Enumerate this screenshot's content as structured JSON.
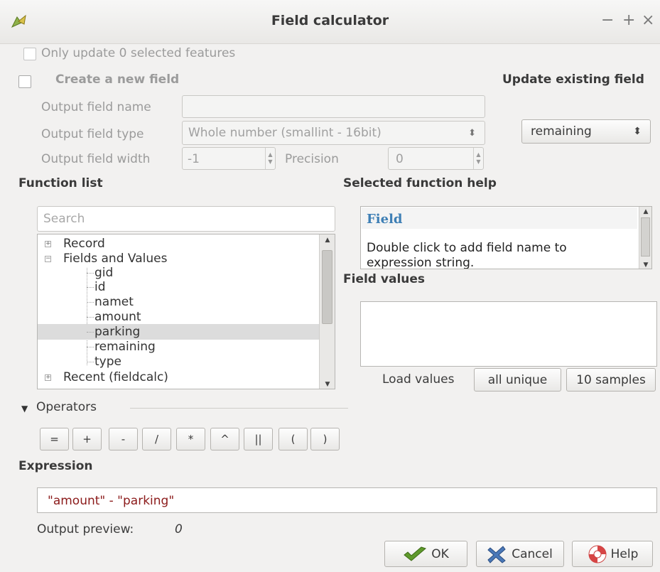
{
  "window": {
    "title": "Field calculator",
    "controls": [
      "−",
      "+",
      "×"
    ]
  },
  "options": {
    "only_update_label": "Only update 0 selected features",
    "create_field_label": "Create a new field",
    "update_existing_label": "Update existing field",
    "output_name_label": "Output field name",
    "output_name_value": "",
    "output_type_label": "Output field type",
    "output_type_value": "Whole number (smallint - 16bit)",
    "output_width_label": "Output field width",
    "output_width_value": "-1",
    "precision_label": "Precision",
    "precision_value": "0",
    "existing_field_value": "remaining"
  },
  "function_list": {
    "heading": "Function list",
    "search_placeholder": "Search",
    "items": [
      {
        "label": "Record",
        "expander": "+"
      },
      {
        "label": "Fields and Values",
        "expander": "−"
      },
      {
        "label": "gid"
      },
      {
        "label": "id"
      },
      {
        "label": "namet"
      },
      {
        "label": "amount"
      },
      {
        "label": "parking",
        "selected": true
      },
      {
        "label": "remaining"
      },
      {
        "label": "type"
      },
      {
        "label": "Recent (fieldcalc)",
        "expander": "+"
      }
    ]
  },
  "help": {
    "heading": "Selected function help",
    "title": "Field",
    "text": "Double click to add field name to expression string."
  },
  "field_values": {
    "heading": "Field values",
    "load_label": "Load values",
    "all_unique_label": "all unique",
    "samples_label": "10 samples"
  },
  "operators": {
    "heading": "Operators",
    "buttons": [
      "=",
      "+",
      "-",
      "/",
      "*",
      "^",
      "||",
      "(",
      ")"
    ]
  },
  "expression": {
    "heading": "Expression",
    "value": "\"amount\" - \"parking\"",
    "preview_label": "Output preview:",
    "preview_value": "0"
  },
  "buttons": {
    "ok": "OK",
    "cancel": "Cancel",
    "help": "Help"
  },
  "colors": {
    "accent_help_title": "#3e7fb5",
    "expression_text": "#8b1a1a",
    "selected_row": "#dcdcdc"
  }
}
